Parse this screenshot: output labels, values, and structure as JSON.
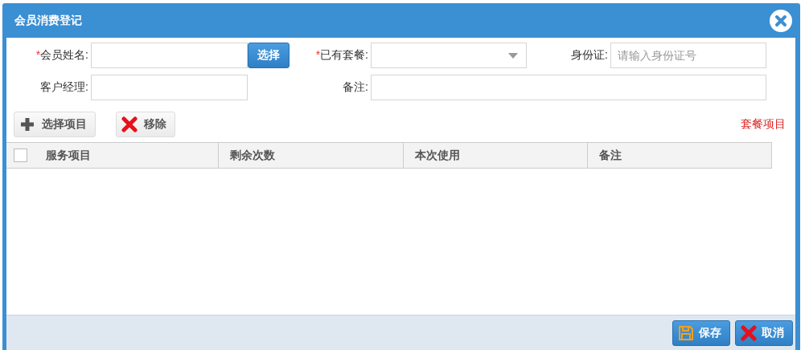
{
  "window": {
    "title": "会员消费登记"
  },
  "form": {
    "required_mark": "*",
    "rows": [
      [
        {
          "kind": "text",
          "label": "会员姓名:",
          "required": true,
          "button": "选择"
        },
        {
          "kind": "select",
          "label": "已有套餐:",
          "required": true
        },
        {
          "kind": "text",
          "label": "身份证:",
          "required": false,
          "placeholder": "请输入身份证号"
        }
      ],
      [
        {
          "kind": "text",
          "label": "客户经理:",
          "required": false
        },
        {
          "kind": "wide",
          "label": "备注:",
          "required": false
        }
      ]
    ]
  },
  "toolbar": {
    "buttons": [
      {
        "kind": "add",
        "label": "选择项目"
      },
      {
        "kind": "remove",
        "label": "移除"
      }
    ],
    "note": "套餐项目"
  },
  "table": {
    "select_all": {
      "checked": false
    },
    "columns": [
      "服务项目",
      "剩余次数",
      "本次使用",
      "备注"
    ]
  },
  "footer": {
    "buttons": [
      {
        "kind": "save",
        "label": "保存"
      },
      {
        "kind": "cancel",
        "label": "取消"
      }
    ]
  }
}
